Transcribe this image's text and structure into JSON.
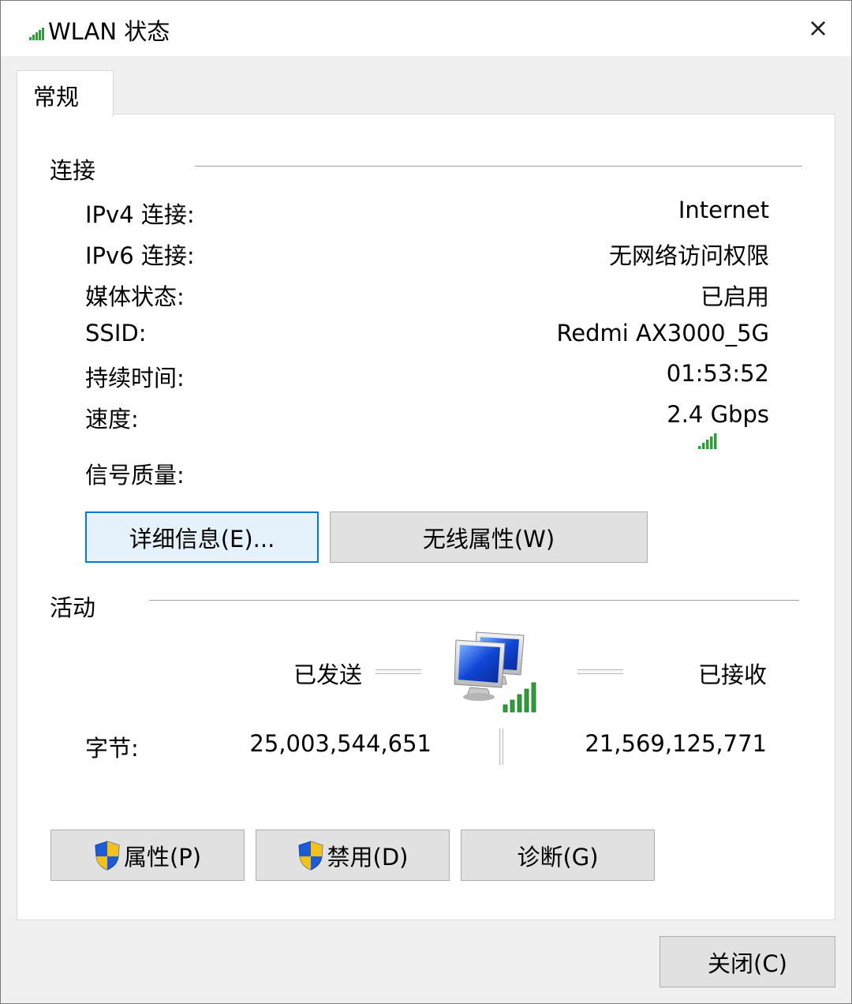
{
  "window": {
    "title": "WLAN 状态",
    "close_glyph": "×",
    "title_icon": "wifi-signal-icon"
  },
  "tabs": [
    {
      "label": "常规",
      "selected": true
    }
  ],
  "connection": {
    "section_title": "连接",
    "rows": [
      {
        "label": "IPv4 连接:",
        "value": "Internet"
      },
      {
        "label": "IPv6 连接:",
        "value": "无网络访问权限"
      },
      {
        "label": "媒体状态:",
        "value": "已启用"
      },
      {
        "label": "SSID:",
        "value": "Redmi AX3000_5G"
      },
      {
        "label": "持续时间:",
        "value": "01:53:52"
      },
      {
        "label": "速度:",
        "value": "2.4 Gbps"
      }
    ],
    "signal_label": "信号质量:",
    "signal_bars_lit": 5,
    "signal_bars_total": 5,
    "details_button": "详细信息(E)...",
    "wireless_props_button": "无线属性(W)"
  },
  "activity": {
    "section_title": "活动",
    "sent_label": "已发送",
    "received_label": "已接收",
    "bytes_label": "字节:",
    "bytes_sent": "25,003,544,651",
    "bytes_received": "21,569,125,771",
    "network_icon": "network-computers-icon"
  },
  "actions": {
    "properties_button": "属性(P)",
    "disable_button": "禁用(D)",
    "diagnose_button": "诊断(G)",
    "close_button": "关闭(C)"
  },
  "colors": {
    "accent": "#0078d7",
    "signal_green": "#2f9e3a",
    "button_face": "#e1e1e1"
  }
}
